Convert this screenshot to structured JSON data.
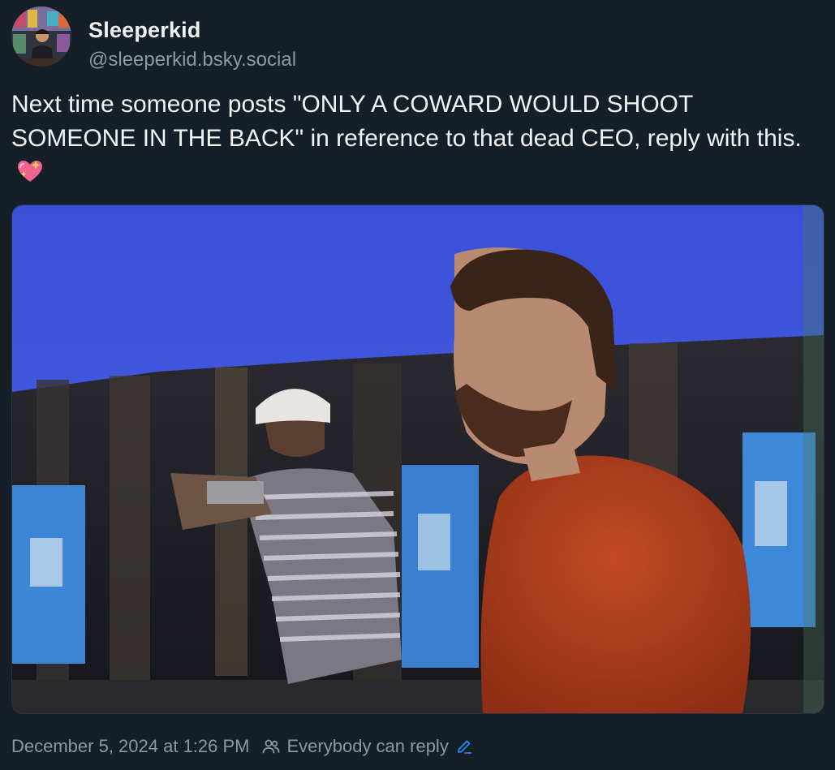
{
  "author": {
    "display_name": "Sleeperkid",
    "handle": "@sleeperkid.bsky.social"
  },
  "post": {
    "text": "Next time someone posts \"ONLY A COWARD WOULD SHOOT SOMEONE IN THE BACK\" in reference to that dead CEO, reply with this.",
    "emoji": "sparkling-heart-emoji"
  },
  "footer": {
    "timestamp": "December 5, 2024 at 1:26 PM",
    "reply_setting": "Everybody can reply"
  },
  "colors": {
    "background": "#161e27",
    "text": "#f1f3f5",
    "muted": "#8b98a8",
    "accent": "#208bfe"
  }
}
